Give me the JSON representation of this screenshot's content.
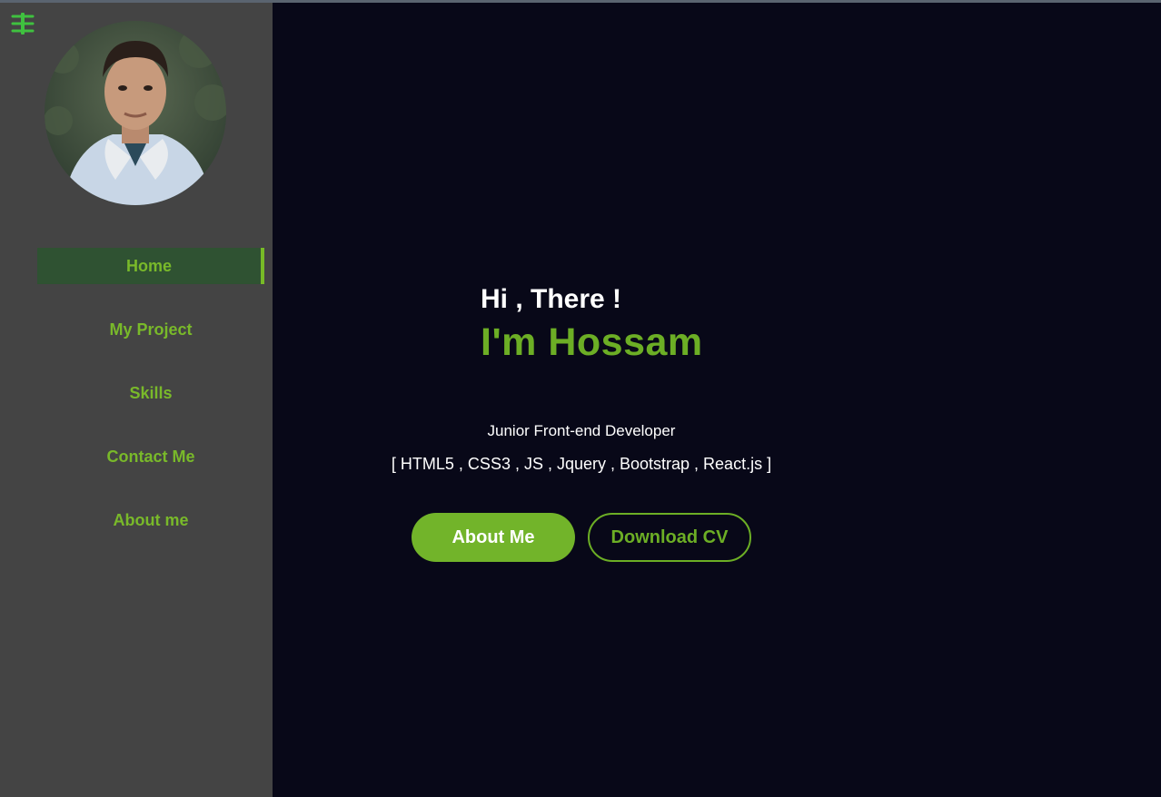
{
  "sidebar": {
    "menu_icon": "hamburger-menu-icon",
    "avatar": "profile-photo",
    "nav": [
      {
        "label": "Home",
        "active": true
      },
      {
        "label": "My Project",
        "active": false
      },
      {
        "label": "Skills",
        "active": false
      },
      {
        "label": "Contact Me",
        "active": false
      },
      {
        "label": "About me",
        "active": false
      }
    ]
  },
  "hero": {
    "greeting": "Hi , There !",
    "name": "I'm Hossam",
    "role": "Junior Front-end Developer",
    "stack": "[ HTML5 , CSS3 , JS , Jquery , Bootstrap , React.js ]",
    "primary_button": "About Me",
    "secondary_button": "Download CV"
  },
  "colors": {
    "accent": "#6cae25",
    "sidebar_bg": "#444444",
    "main_bg": "#080818",
    "active_nav_bg": "#2f5232"
  }
}
